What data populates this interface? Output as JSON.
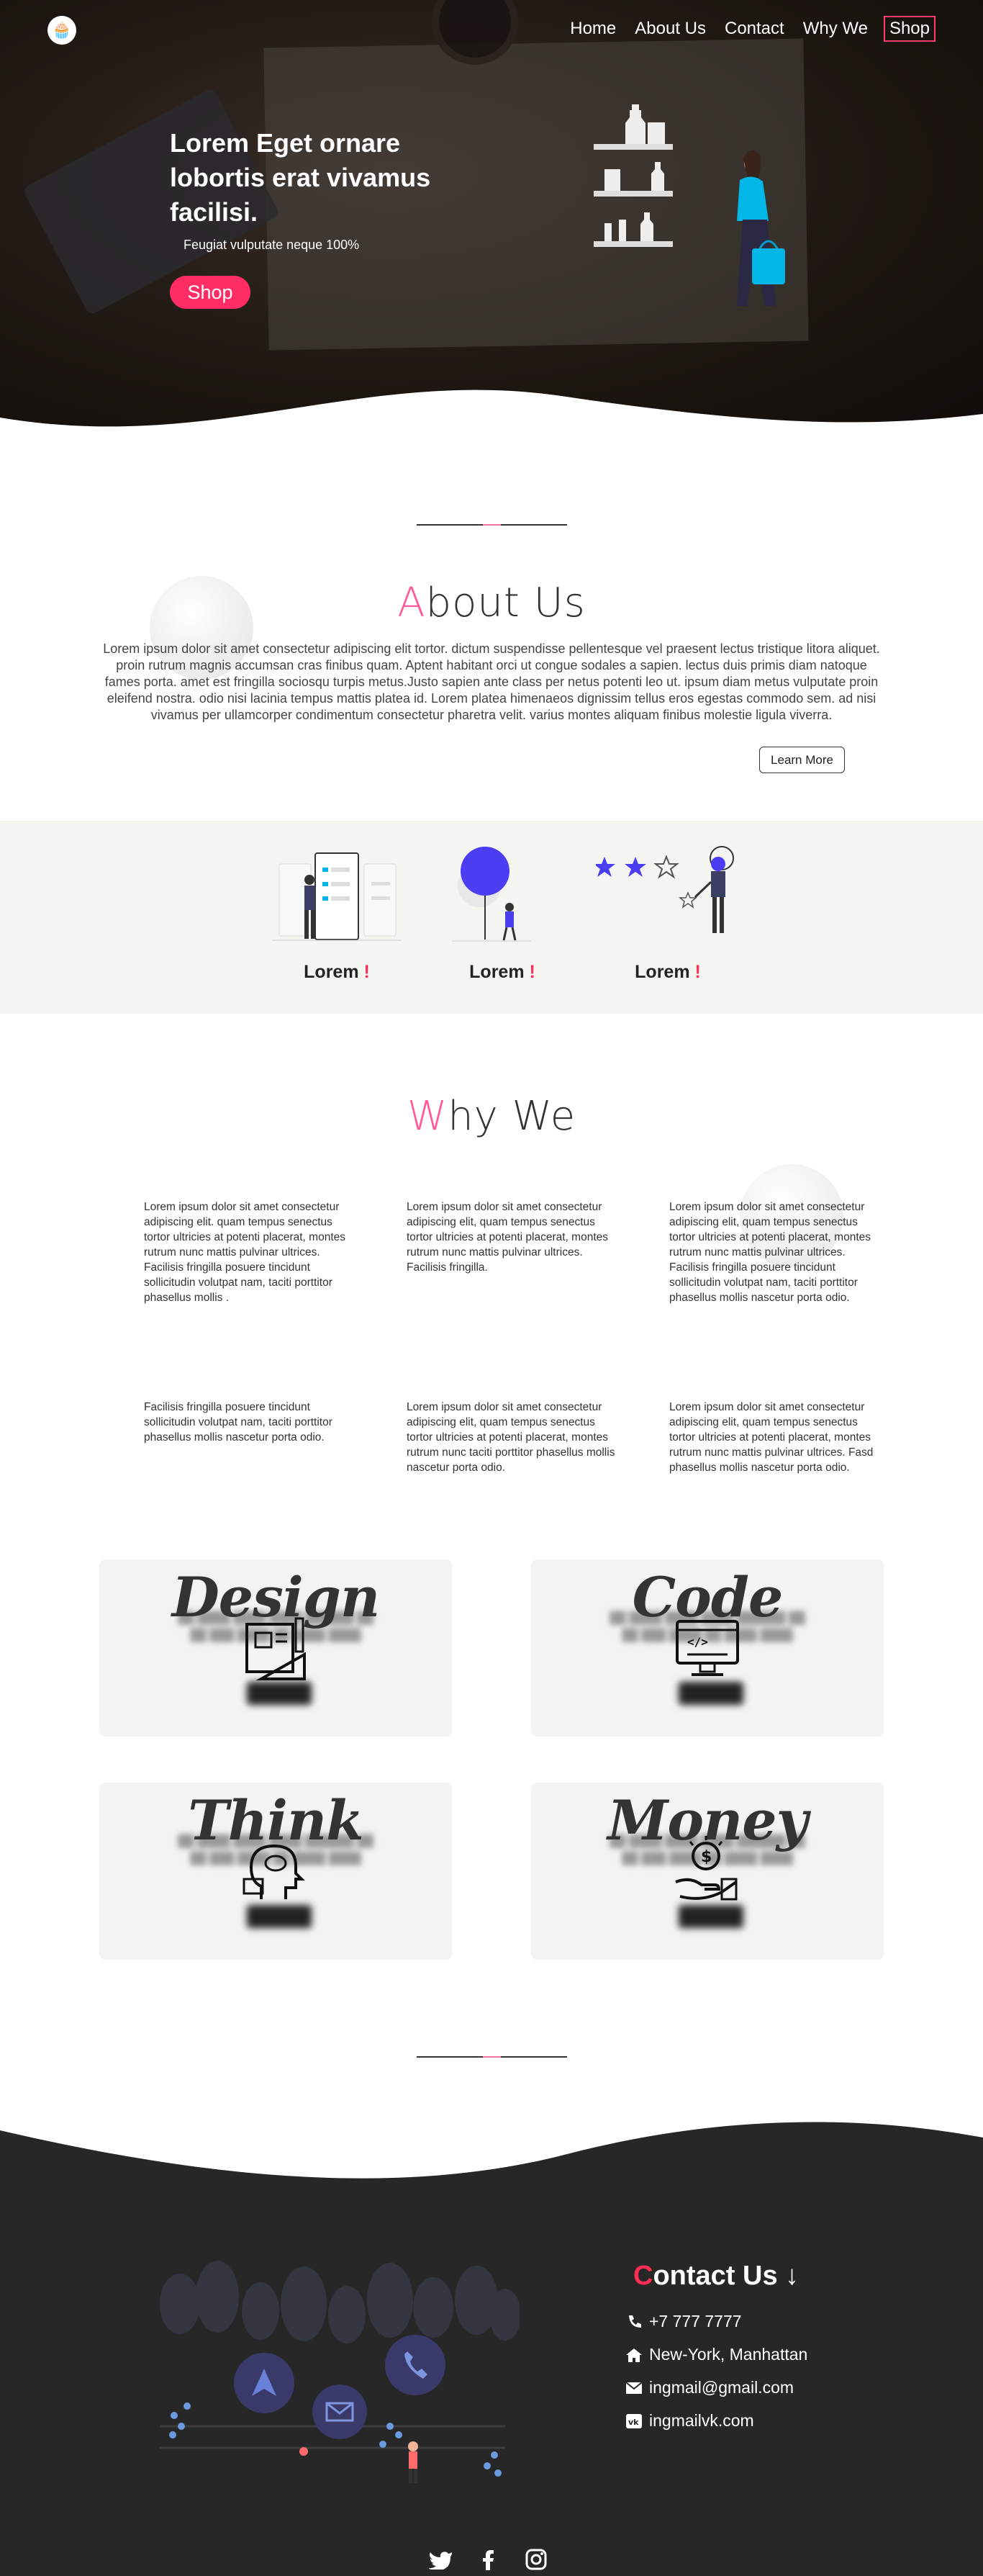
{
  "nav": {
    "logo_glyph": "🧁",
    "items": [
      {
        "label": "Home"
      },
      {
        "label": "About Us"
      },
      {
        "label": "Contact"
      },
      {
        "label": "Why We"
      },
      {
        "label": "Shop"
      }
    ]
  },
  "hero": {
    "title": "Lorem Eget ornare lobortis erat vivamus facilisi.",
    "subtitle": "Feugiat vulputate neque 100%",
    "button": "Shop"
  },
  "about": {
    "title_first": "A",
    "title_rest": "bout Us",
    "text": "Lorem ipsum dolor sit amet consectetur adipiscing elit tortor. dictum suspendisse pellentesque vel praesent lectus tristique litora aliquet. proin rutrum magnis accumsan cras finibus quam. Aptent habitant orci ut congue sodales a sapien. lectus duis primis diam natoque fames porta. amet est fringilla sociosqu turpis metus.Justo sapien ante class per netus potenti leo ut. ipsum diam metus vulputate proin eleifend nostra. odio nisi lacinia tempus mattis platea id. Lorem platea himenaeos dignissim tellus eros egestas commodo sem. ad nisi vivamus per ullamcorper condimentum consectetur pharetra velit. varius montes aliquam finibus molestie ligula viverra.",
    "button": "Learn More"
  },
  "features": [
    {
      "label": "Lorem",
      "mark": "!"
    },
    {
      "label": "Lorem",
      "mark": "!"
    },
    {
      "label": "Lorem",
      "mark": "!"
    }
  ],
  "why": {
    "title_first": "W",
    "title_rest": "hy We",
    "cells": [
      "Lorem ipsum dolor sit amet consectetur adipiscing elit. quam tempus senectus tortor ultricies at potenti placerat, montes rutrum nunc mattis pulvinar ultrices. Facilisis fringilla posuere tincidunt sollicitudin volutpat nam, taciti porttitor phasellus mollis .",
      "Lorem ipsum dolor sit amet consectetur adipiscing elit, quam tempus senectus tortor ultricies at potenti placerat, montes rutrum nunc mattis pulvinar ultrices. Facilisis fringilla.",
      "Lorem ipsum dolor sit amet consectetur adipiscing elit, quam tempus senectus tortor ultricies at potenti placerat, montes rutrum nunc mattis pulvinar ultrices. Facilisis fringilla posuere tincidunt sollicitudin volutpat nam, taciti porttitor phasellus mollis nascetur porta odio.",
      "Facilisis fringilla posuere tincidunt sollicitudin volutpat nam, taciti porttitor phasellus mollis nascetur porta odio.",
      "Lorem ipsum dolor sit amet consectetur adipiscing elit, quam tempus senectus tortor ultricies at potenti placerat, montes rutrum nunc taciti porttitor phasellus mollis nascetur porta odio.",
      "Lorem ipsum dolor sit amet consectetur adipiscing elit, quam tempus senectus tortor ultricies at potenti placerat, montes rutrum nunc mattis pulvinar ultrices. Fasd phasellus mollis nascetur porta odio."
    ]
  },
  "cards": [
    {
      "title": "Design",
      "icon": "blueprint-icon"
    },
    {
      "title": "Code",
      "icon": "code-monitor-icon"
    },
    {
      "title": "Think",
      "icon": "thinking-head-icon"
    },
    {
      "title": "Money",
      "icon": "money-hand-icon"
    }
  ],
  "contact": {
    "title_first": "C",
    "title_rest": "ontact Us ↓",
    "phone": "+7 777 7777",
    "address": "New-York, Manhattan",
    "email": "ingmail@gmail.com",
    "vk": "ingmailvk.com"
  },
  "socials": [
    {
      "icon": "twitter-icon"
    },
    {
      "icon": "facebook-icon"
    },
    {
      "icon": "instagram-icon"
    }
  ],
  "colors": {
    "accent": "#ff2d63",
    "pink": "#ff5a9a",
    "footer": "#272727",
    "strip": "#f4f5f0",
    "purple": "#4b3df2",
    "cyan": "#00b7e8"
  }
}
